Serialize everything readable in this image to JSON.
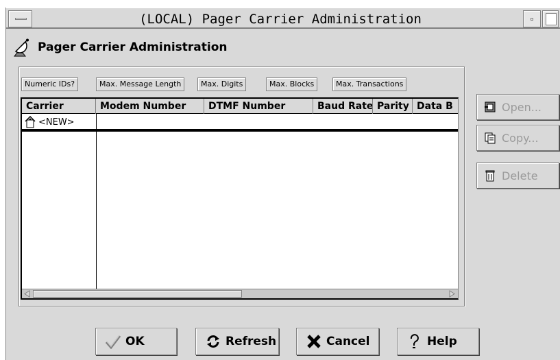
{
  "window": {
    "title": "(LOCAL) Pager Carrier Administration"
  },
  "header": {
    "title": "Pager Carrier Administration",
    "icon": "satellite-dish-icon"
  },
  "column_buttons": [
    {
      "label": "Numeric IDs?"
    },
    {
      "label": "Max. Message Length"
    },
    {
      "label": "Max. Digits"
    },
    {
      "label": "Max. Blocks"
    },
    {
      "label": "Max. Transactions"
    }
  ],
  "grid": {
    "columns": [
      "Carrier",
      "Modem Number",
      "DTMF Number",
      "Baud Rate",
      "Parity",
      "Data B"
    ],
    "rows": [
      {
        "carrier": "<NEW>"
      }
    ]
  },
  "side_buttons": {
    "open": "Open...",
    "copy": "Copy...",
    "delete": "Delete"
  },
  "bottom_buttons": {
    "ok": "OK",
    "refresh": "Refresh",
    "cancel": "Cancel",
    "help": "Help"
  },
  "colors": {
    "window_bg": "#d9d9d9",
    "disabled_text": "#9a9a9a"
  }
}
